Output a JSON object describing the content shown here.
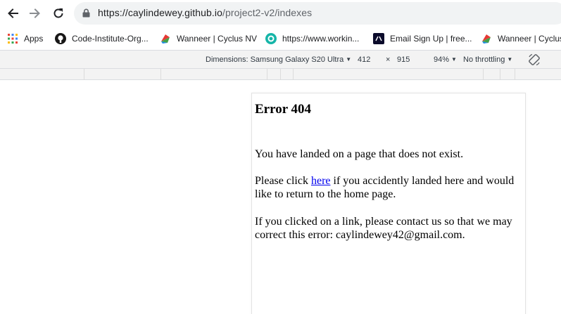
{
  "browser": {
    "url_host": "https://caylindewey.github.io",
    "url_path": "/project2-v2/indexes"
  },
  "bookmarks": [
    {
      "label": "Apps",
      "icon": "apps-grid-icon"
    },
    {
      "label": "Code-Institute-Org...",
      "icon": "github-icon"
    },
    {
      "label": "Wanneer | Cyclus NV",
      "icon": "cyclus-icon"
    },
    {
      "label": "https://www.workin...",
      "icon": "workin-icon"
    },
    {
      "label": "Email Sign Up | free...",
      "icon": "email-signup-icon"
    },
    {
      "label": "Wanneer | Cyclus",
      "icon": "cyclus-icon"
    }
  ],
  "devtools": {
    "dimensions_label": "Dimensions: Samsung Galaxy S20 Ultra",
    "width": "412",
    "times": "×",
    "height": "915",
    "zoom": "94%",
    "throttling": "No throttling"
  },
  "page": {
    "heading": "Error 404",
    "para1": "You have landed on a page that does not exist.",
    "para2_before": "Please click ",
    "para2_link": "here",
    "para2_after": " if you accidently landed here and would like to return to the home page.",
    "para3": "If you clicked on a link, please contact us so that we may correct this error: caylindewey42@gmail.com."
  },
  "colors": {
    "link": "#0000ee",
    "toolbar_bg": "#f3f3f3",
    "omnibox_bg": "#f1f3f4"
  }
}
